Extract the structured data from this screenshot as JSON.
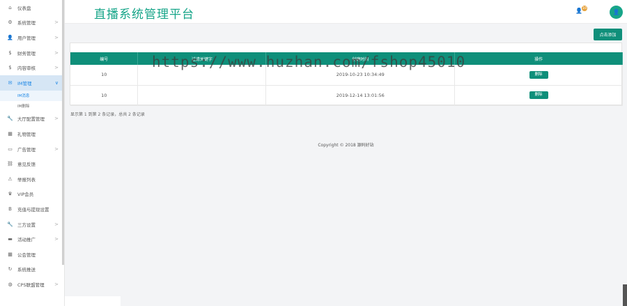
{
  "brand": {
    "title": "直播系统管理平台"
  },
  "header": {
    "badge_count": "10"
  },
  "sidebar": {
    "items": [
      {
        "label": "仪表盘",
        "icon": "home-icon",
        "glyph": "⌂",
        "chevron": ""
      },
      {
        "label": "系统管理",
        "icon": "org-icon",
        "glyph": "⚙",
        "chevron": ">"
      },
      {
        "label": "用户管理",
        "icon": "user-icon",
        "glyph": "👤",
        "chevron": ">"
      },
      {
        "label": "财务管理",
        "icon": "dollar-icon",
        "glyph": "$",
        "chevron": ">"
      },
      {
        "label": "内容审核",
        "icon": "dollar-icon",
        "glyph": "$",
        "chevron": ">"
      },
      {
        "label": "IM管理",
        "icon": "mail-icon",
        "glyph": "✉",
        "chevron": "∨",
        "active": true
      },
      {
        "label": "IM消息",
        "sub": true,
        "active": true
      },
      {
        "label": "IM删除",
        "sub": true
      },
      {
        "label": "大厅配置管理",
        "icon": "wrench-icon",
        "glyph": "🔧",
        "chevron": ">"
      },
      {
        "label": "礼物管理",
        "icon": "gift-icon",
        "glyph": "▦",
        "chevron": ""
      },
      {
        "label": "广告管理",
        "icon": "monitor-icon",
        "glyph": "▭",
        "chevron": ">"
      },
      {
        "label": "意见反馈",
        "icon": "link-icon",
        "glyph": "⛓",
        "chevron": ""
      },
      {
        "label": "举报列表",
        "icon": "warning-icon",
        "glyph": "⚠",
        "chevron": ""
      },
      {
        "label": "VIP会员",
        "icon": "crown-icon",
        "glyph": "♛",
        "chevron": ""
      },
      {
        "label": "充值与提现设置",
        "icon": "bitcoin-icon",
        "glyph": "B",
        "chevron": ""
      },
      {
        "label": "三方设置",
        "icon": "wrench-icon",
        "glyph": "🔧",
        "chevron": ">"
      },
      {
        "label": "活动推广",
        "icon": "folder-icon",
        "glyph": "▬",
        "chevron": ">"
      },
      {
        "label": "公会管理",
        "icon": "grid-icon",
        "glyph": "▦",
        "chevron": ""
      },
      {
        "label": "系统推送",
        "icon": "refresh-icon",
        "glyph": "↻",
        "chevron": ""
      },
      {
        "label": "CPS联盟管理",
        "icon": "globe-icon",
        "glyph": "◍",
        "chevron": ">"
      }
    ]
  },
  "toolbar": {
    "add_label": "点击添加"
  },
  "table": {
    "headers": [
      "编号",
      "过滤关键字",
      "创建时间",
      "操作"
    ],
    "rows": [
      {
        "id": "10",
        "keyword": "",
        "time": "2019-10-23 10:34:49",
        "action": "删除"
      },
      {
        "id": "10",
        "keyword": "",
        "time": "2019-12-14 13:01:56",
        "action": "删除"
      }
    ]
  },
  "pager": {
    "text": "显示第 1 到第 2 条记录，总共 2 条记录"
  },
  "footer": {
    "text": "Copyright © 2018 源码好站"
  },
  "watermark": {
    "text": "https://www.huzhan.com/fshop45010"
  },
  "colors": {
    "accent": "#0f8f7a",
    "brand": "#17a589",
    "active_bg": "#d6e6f5",
    "active_text": "#1e88e5"
  }
}
